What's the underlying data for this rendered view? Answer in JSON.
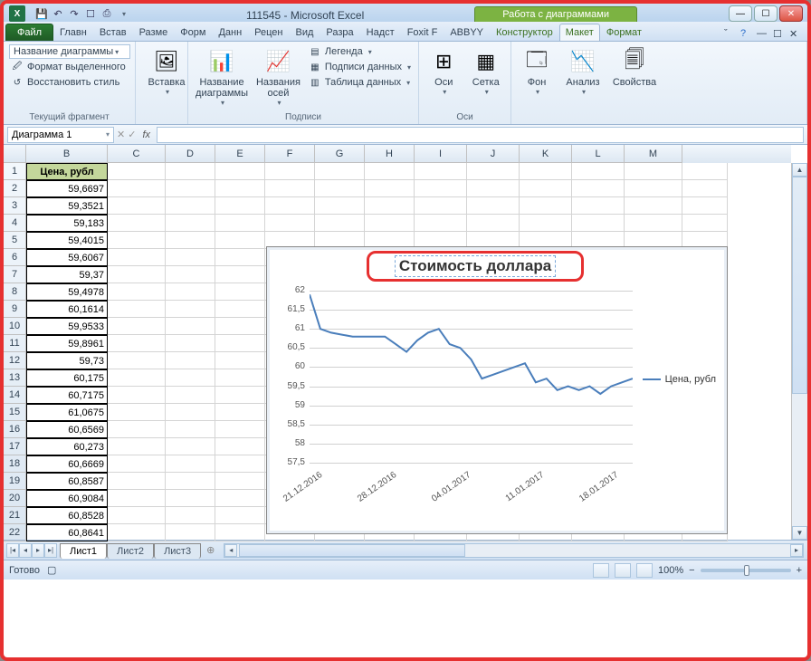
{
  "window": {
    "title": "111545 - Microsoft Excel",
    "context_title": "Работа с диаграммами"
  },
  "tabs": {
    "file": "Файл",
    "items": [
      "Главн",
      "Встав",
      "Разме",
      "Форм",
      "Данн",
      "Рецен",
      "Вид",
      "Разра",
      "Надст",
      "Foxit F",
      "ABBYY"
    ],
    "ctx": [
      "Конструктор",
      "Макет",
      "Формат"
    ],
    "active": "Макет"
  },
  "ribbon": {
    "g1_title": "Текущий фрагмент",
    "g1_combo": "Название диаграммы",
    "g1_fmt": "Формат выделенного",
    "g1_reset": "Восстановить стиль",
    "g2_insert": "Вставка",
    "g3_title": "Подписи",
    "g3_chart_title": "Название диаграммы",
    "g3_axis_title": "Названия осей",
    "g3_legend": "Легенда",
    "g3_data_labels": "Подписи данных",
    "g3_data_table": "Таблица данных",
    "g4_title": "Оси",
    "g4_axes": "Оси",
    "g4_grid": "Сетка",
    "g5_bg": "Фон",
    "g5_analysis": "Анализ",
    "g5_props": "Свойства"
  },
  "namebox": "Диаграмма 1",
  "columns": [
    "B",
    "C",
    "D",
    "E",
    "F",
    "G",
    "H",
    "I",
    "J",
    "K",
    "L",
    "M"
  ],
  "col_b_header": "Цена, рубл",
  "col_b_values": [
    "59,6697",
    "59,3521",
    "59,183",
    "59,4015",
    "59,6067",
    "59,37",
    "59,4978",
    "60,1614",
    "59,9533",
    "59,8961",
    "59,73",
    "60,175",
    "60,7175",
    "61,0675",
    "60,6569",
    "60,273",
    "60,6669",
    "60,8587",
    "60,9084",
    "60,8528",
    "60,8641"
  ],
  "sheets": [
    "Лист1",
    "Лист2",
    "Лист3"
  ],
  "status": {
    "ready": "Готово",
    "zoom": "100%"
  },
  "chart_data": {
    "type": "line",
    "title": "Стоимость доллара",
    "legend_label": "Цена, рубл",
    "ylim": [
      57.5,
      62
    ],
    "ytick_step": 0.5,
    "yticks": [
      "62",
      "61,5",
      "61",
      "60,5",
      "60",
      "59,5",
      "59",
      "58,5",
      "58",
      "57,5"
    ],
    "xticks": [
      "21.12.2016",
      "28.12.2016",
      "04.01.2017",
      "11.01.2017",
      "18.01.2017"
    ],
    "values": [
      61.9,
      61.0,
      60.9,
      60.85,
      60.8,
      60.8,
      60.8,
      60.8,
      60.6,
      60.4,
      60.7,
      60.9,
      61.0,
      60.6,
      60.5,
      60.2,
      59.7,
      59.8,
      59.9,
      60.0,
      60.1,
      59.6,
      59.7,
      59.4,
      59.5,
      59.4,
      59.5,
      59.3,
      59.5,
      59.6,
      59.7
    ]
  }
}
